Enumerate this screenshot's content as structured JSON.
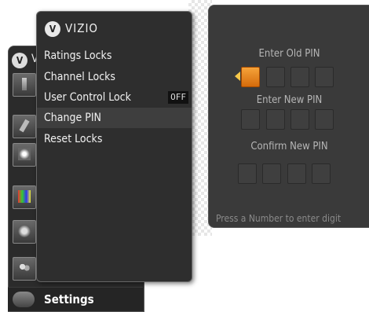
{
  "main_menu": {
    "logo_letter": "V",
    "title_partial": "V",
    "icons": [
      "pencil-icon",
      "remote-icon",
      "antenna-icon",
      "picture-icon",
      "audio-icon",
      "users-icon"
    ],
    "settings_label": "Settings"
  },
  "sub_menu": {
    "logo_letter": "V",
    "brand": "VIZIO",
    "items": [
      {
        "label": "Ratings Locks",
        "badge": ""
      },
      {
        "label": "Channel Locks",
        "badge": ""
      },
      {
        "label": "User Control Lock",
        "badge": "OFF"
      },
      {
        "label": "Change PIN",
        "badge": ""
      },
      {
        "label": "Reset Locks",
        "badge": ""
      }
    ],
    "selected_index": 3
  },
  "pin_panel": {
    "old_label": "Enter Old PIN",
    "new_label": "Enter New PIN",
    "confirm_label": "Confirm New PIN",
    "hint": "Press a Number to enter digit",
    "active_color": "#f08a1c"
  }
}
